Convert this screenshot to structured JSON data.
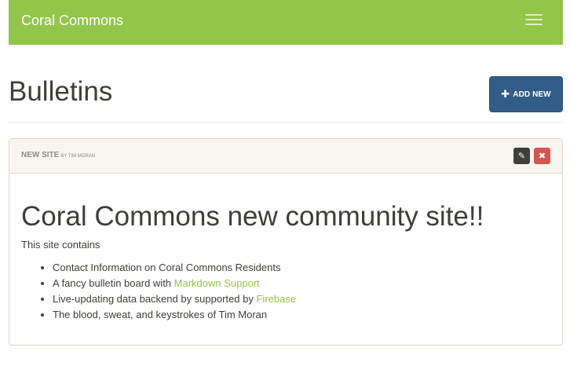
{
  "navbar": {
    "brand": "Coral Commons"
  },
  "header": {
    "title": "Bulletins",
    "add_button_icon": "plus-icon",
    "add_button_label": "ADD NEW"
  },
  "bulletin": {
    "title": "NEW SITE",
    "byline": "BY TIM MORAN",
    "edit_icon": "edit-icon",
    "delete_icon": "close-icon",
    "heading": "Coral Commons new community site!!",
    "intro": "This site contains",
    "items": [
      {
        "text": "Contact Information on Coral Commons Residents"
      },
      {
        "text": "A fancy bulletin board with ",
        "link": "Markdown Support"
      },
      {
        "text": "Live-updating data backend by supported by ",
        "link": "Firebase"
      },
      {
        "text": "The blood, sweat, and keystrokes of Tim Moran"
      }
    ]
  },
  "colors": {
    "navbar": "#93c54b",
    "primary_button": "#325d88",
    "danger_button": "#d9534f",
    "dark_button": "#3e3f3a",
    "link": "#93c54b",
    "panel_heading": "#f8f5f0"
  }
}
